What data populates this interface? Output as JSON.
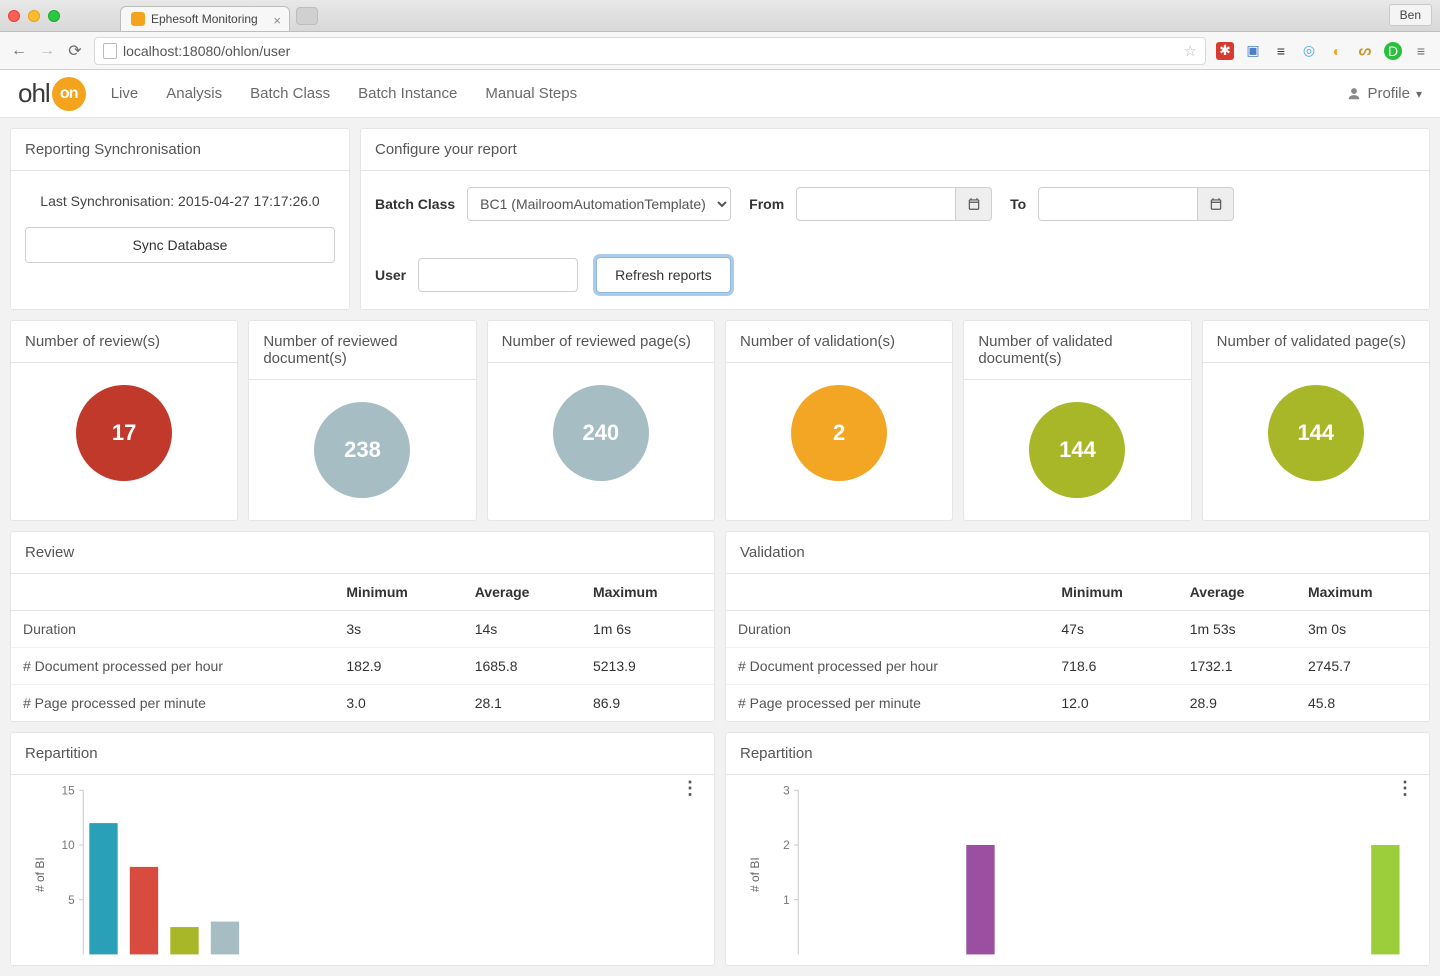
{
  "browser": {
    "tab_title": "Ephesoft Monitoring",
    "url": "localhost:18080/ohlon/user",
    "profile_name": "Ben"
  },
  "logo": {
    "left": "ohl",
    "badge": "on"
  },
  "nav": {
    "items": [
      "Live",
      "Analysis",
      "Batch Class",
      "Batch Instance",
      "Manual Steps"
    ]
  },
  "profile_menu": {
    "label": "Profile"
  },
  "sync": {
    "title": "Reporting Synchronisation",
    "status_prefix": "Last Synchronisation: ",
    "status_value": "2015-04-27 17:17:26.0",
    "button": "Sync Database"
  },
  "config": {
    "title": "Configure your report",
    "batch_class_label": "Batch Class",
    "batch_class_value": "BC1 (MailroomAutomationTemplate)",
    "from_label": "From",
    "to_label": "To",
    "user_label": "User",
    "user_value": "",
    "refresh_label": "Refresh reports"
  },
  "circle_cards": [
    {
      "title": "Number of review(s)",
      "value": "17",
      "color": "#c1392b"
    },
    {
      "title": "Number of reviewed document(s)",
      "value": "238",
      "color": "#a5bdc3"
    },
    {
      "title": "Number of reviewed page(s)",
      "value": "240",
      "color": "#a5bdc3"
    },
    {
      "title": "Number of validation(s)",
      "value": "2",
      "color": "#f2a624"
    },
    {
      "title": "Number of validated document(s)",
      "value": "144",
      "color": "#a7b727"
    },
    {
      "title": "Number of validated page(s)",
      "value": "144",
      "color": "#a7b727"
    }
  ],
  "stats_headers": [
    "",
    "Minimum",
    "Average",
    "Maximum"
  ],
  "review_stats": {
    "title": "Review",
    "rows": [
      {
        "label": "Duration",
        "min": "3s",
        "avg": "14s",
        "max": "1m 6s"
      },
      {
        "label": "# Document processed per hour",
        "min": "182.9",
        "avg": "1685.8",
        "max": "5213.9"
      },
      {
        "label": "# Page processed per minute",
        "min": "3.0",
        "avg": "28.1",
        "max": "86.9"
      }
    ]
  },
  "validation_stats": {
    "title": "Validation",
    "rows": [
      {
        "label": "Duration",
        "min": "47s",
        "avg": "1m 53s",
        "max": "3m 0s"
      },
      {
        "label": "# Document processed per hour",
        "min": "718.6",
        "avg": "1732.1",
        "max": "2745.7"
      },
      {
        "label": "# Page processed per minute",
        "min": "12.0",
        "avg": "28.9",
        "max": "45.8"
      }
    ]
  },
  "repartition": {
    "title": "Repartition",
    "ylabel": "# of BI"
  },
  "chart_data": [
    {
      "type": "bar",
      "title": "Repartition (Review)",
      "ylabel": "# of BI",
      "ylim": [
        0,
        15
      ],
      "yticks": [
        5,
        10,
        15
      ],
      "series": [
        {
          "values": [
            12,
            8,
            2.5,
            3,
            0,
            0,
            0,
            0,
            0,
            0,
            0,
            0,
            0,
            0,
            0
          ],
          "colors": [
            "#2aa0b8",
            "#d84b3f",
            "#a7b727",
            "#a5bdc3",
            "#444",
            "#444",
            "#444",
            "#444",
            "#444",
            "#444",
            "#444",
            "#444",
            "#444",
            "#444",
            "#444"
          ]
        }
      ]
    },
    {
      "type": "bar",
      "title": "Repartition (Validation)",
      "ylabel": "# of BI",
      "ylim": [
        0,
        3
      ],
      "yticks": [
        1,
        2,
        3
      ],
      "series": [
        {
          "values": [
            0,
            0,
            0,
            0,
            2,
            0,
            0,
            0,
            0,
            0,
            0,
            0,
            0,
            0,
            2
          ],
          "colors": [
            "#444",
            "#444",
            "#444",
            "#444",
            "#9a4fa0",
            "#444",
            "#444",
            "#444",
            "#444",
            "#444",
            "#444",
            "#444",
            "#444",
            "#444",
            "#9ccd3a"
          ]
        }
      ]
    }
  ]
}
